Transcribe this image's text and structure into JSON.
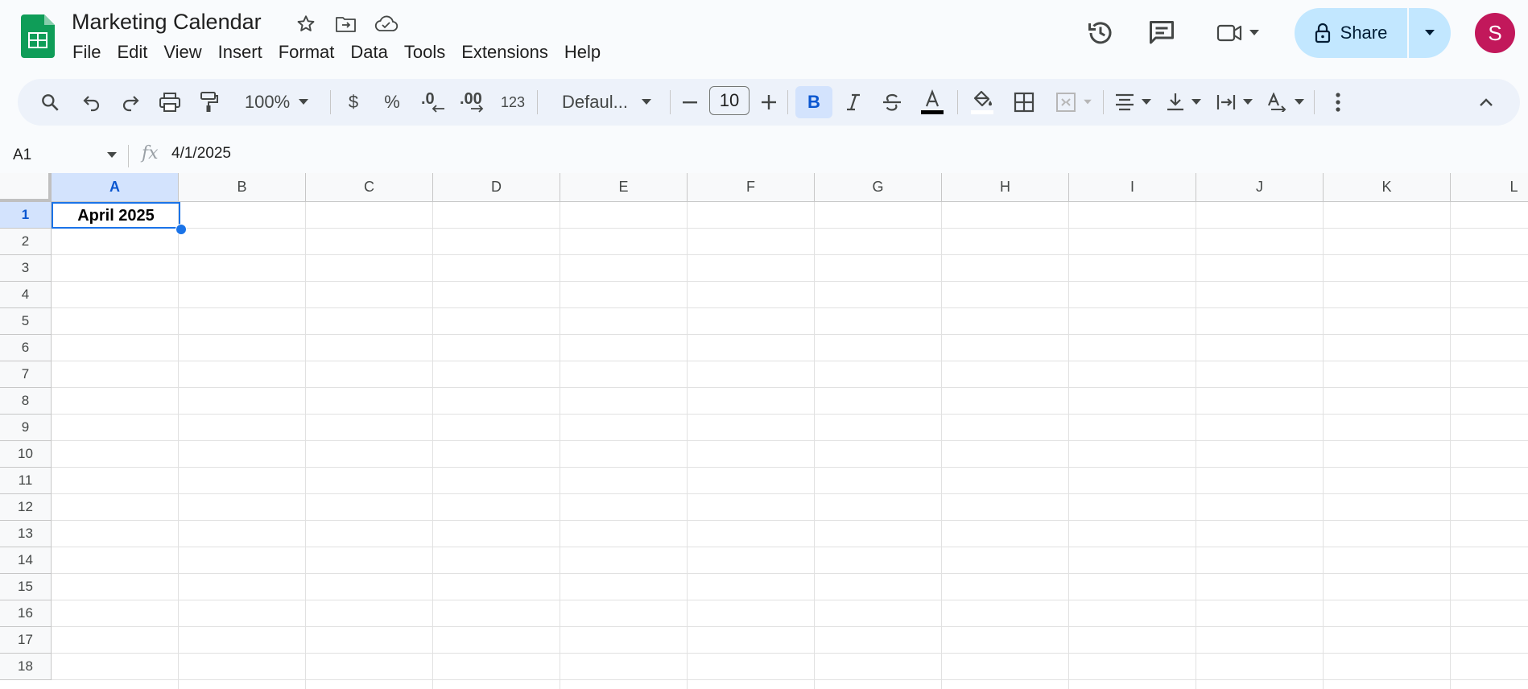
{
  "app": {
    "title": "Marketing Calendar",
    "menu": [
      "File",
      "Edit",
      "View",
      "Insert",
      "Format",
      "Data",
      "Tools",
      "Extensions",
      "Help"
    ],
    "share_label": "Share",
    "avatar_initial": "S"
  },
  "toolbar": {
    "zoom": "100%",
    "currency": "$",
    "percent": "%",
    "decrease_decimal": ".0",
    "increase_decimal": ".00",
    "number_format": "123",
    "font": "Defaul...",
    "font_size": "10",
    "bold": "B"
  },
  "formula_bar": {
    "cell_ref": "A1",
    "fx": "fx",
    "value": "4/1/2025"
  },
  "sheet": {
    "columns": [
      "A",
      "B",
      "C",
      "D",
      "E",
      "F",
      "G",
      "H",
      "I",
      "J",
      "K",
      "L"
    ],
    "rows": [
      "1",
      "2",
      "3",
      "4",
      "5",
      "6",
      "7",
      "8",
      "9",
      "10",
      "11",
      "12",
      "13",
      "14",
      "15",
      "16",
      "17",
      "18"
    ],
    "cells": {
      "A1": "April 2025"
    },
    "selected_cell": "A1"
  },
  "colors": {
    "brand_green": "#0f9d58",
    "accent_blue": "#1a73e8",
    "share_bg": "#c2e7ff",
    "avatar_bg": "#c2185b"
  }
}
